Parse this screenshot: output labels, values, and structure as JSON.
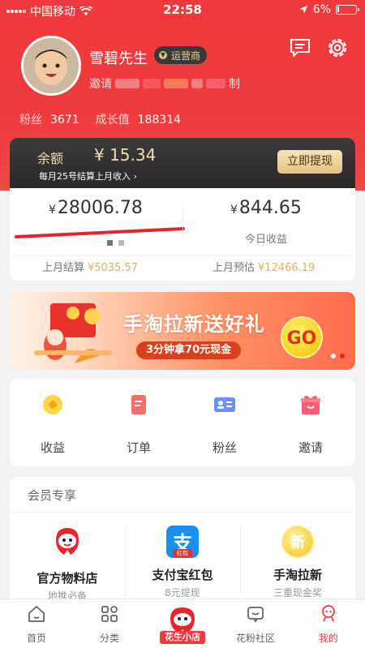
{
  "status_bar": {
    "carrier": "中国移动",
    "time": "22:58",
    "battery": "6%",
    "battery_level": 0.06
  },
  "profile": {
    "nickname": "雪碧先生",
    "role_badge": "运营商",
    "invite_prefix": "邀请",
    "invite_suffix": "制",
    "followers_label": "粉丝",
    "followers_value": "3671",
    "growth_label": "成长值",
    "growth_value": "188314"
  },
  "balance": {
    "label": "余额",
    "value": "¥ 15.34",
    "note": "每月25号结算上月收入 ›",
    "withdraw_button": "立即提现"
  },
  "earnings": {
    "currency": "¥",
    "main_value": "28006.78",
    "today_value": "844.65",
    "today_label": "今日收益",
    "last_month_label": "上月结算",
    "last_month_value": "¥5035.57",
    "estimate_label": "上月预估",
    "estimate_value": "¥12466.19"
  },
  "banner": {
    "title": "手淘拉新送好礼",
    "subtitle": "3分钟拿70元现金",
    "go": "GO"
  },
  "grid": [
    {
      "label": "收益",
      "icon": "coin-icon"
    },
    {
      "label": "订单",
      "icon": "order-icon"
    },
    {
      "label": "粉丝",
      "icon": "fans-card-icon"
    },
    {
      "label": "邀请",
      "icon": "gift-icon"
    }
  ],
  "member": {
    "title": "会员专享",
    "items": [
      {
        "name": "官方物料店",
        "sub": "地推必备",
        "icon": "mascot-icon"
      },
      {
        "name": "支付宝红包",
        "sub": "8元提现",
        "icon": "alipay-icon",
        "glyph": "支",
        "tag": "红包"
      },
      {
        "name": "手淘拉新",
        "sub": "三重现金奖",
        "icon": "new-badge-icon",
        "glyph": "新"
      }
    ]
  },
  "tabbar": [
    {
      "label": "首页",
      "icon": "home-icon"
    },
    {
      "label": "分类",
      "icon": "category-icon"
    },
    {
      "label": "花生小店",
      "icon": "shop-mascot-icon"
    },
    {
      "label": "花粉社区",
      "icon": "community-icon"
    },
    {
      "label": "我的",
      "icon": "profile-icon",
      "active": true
    }
  ],
  "colors": {
    "brand_red": "#ee3b3f",
    "gold": "#d8b36e",
    "dark_card": "#2f2d2d"
  }
}
